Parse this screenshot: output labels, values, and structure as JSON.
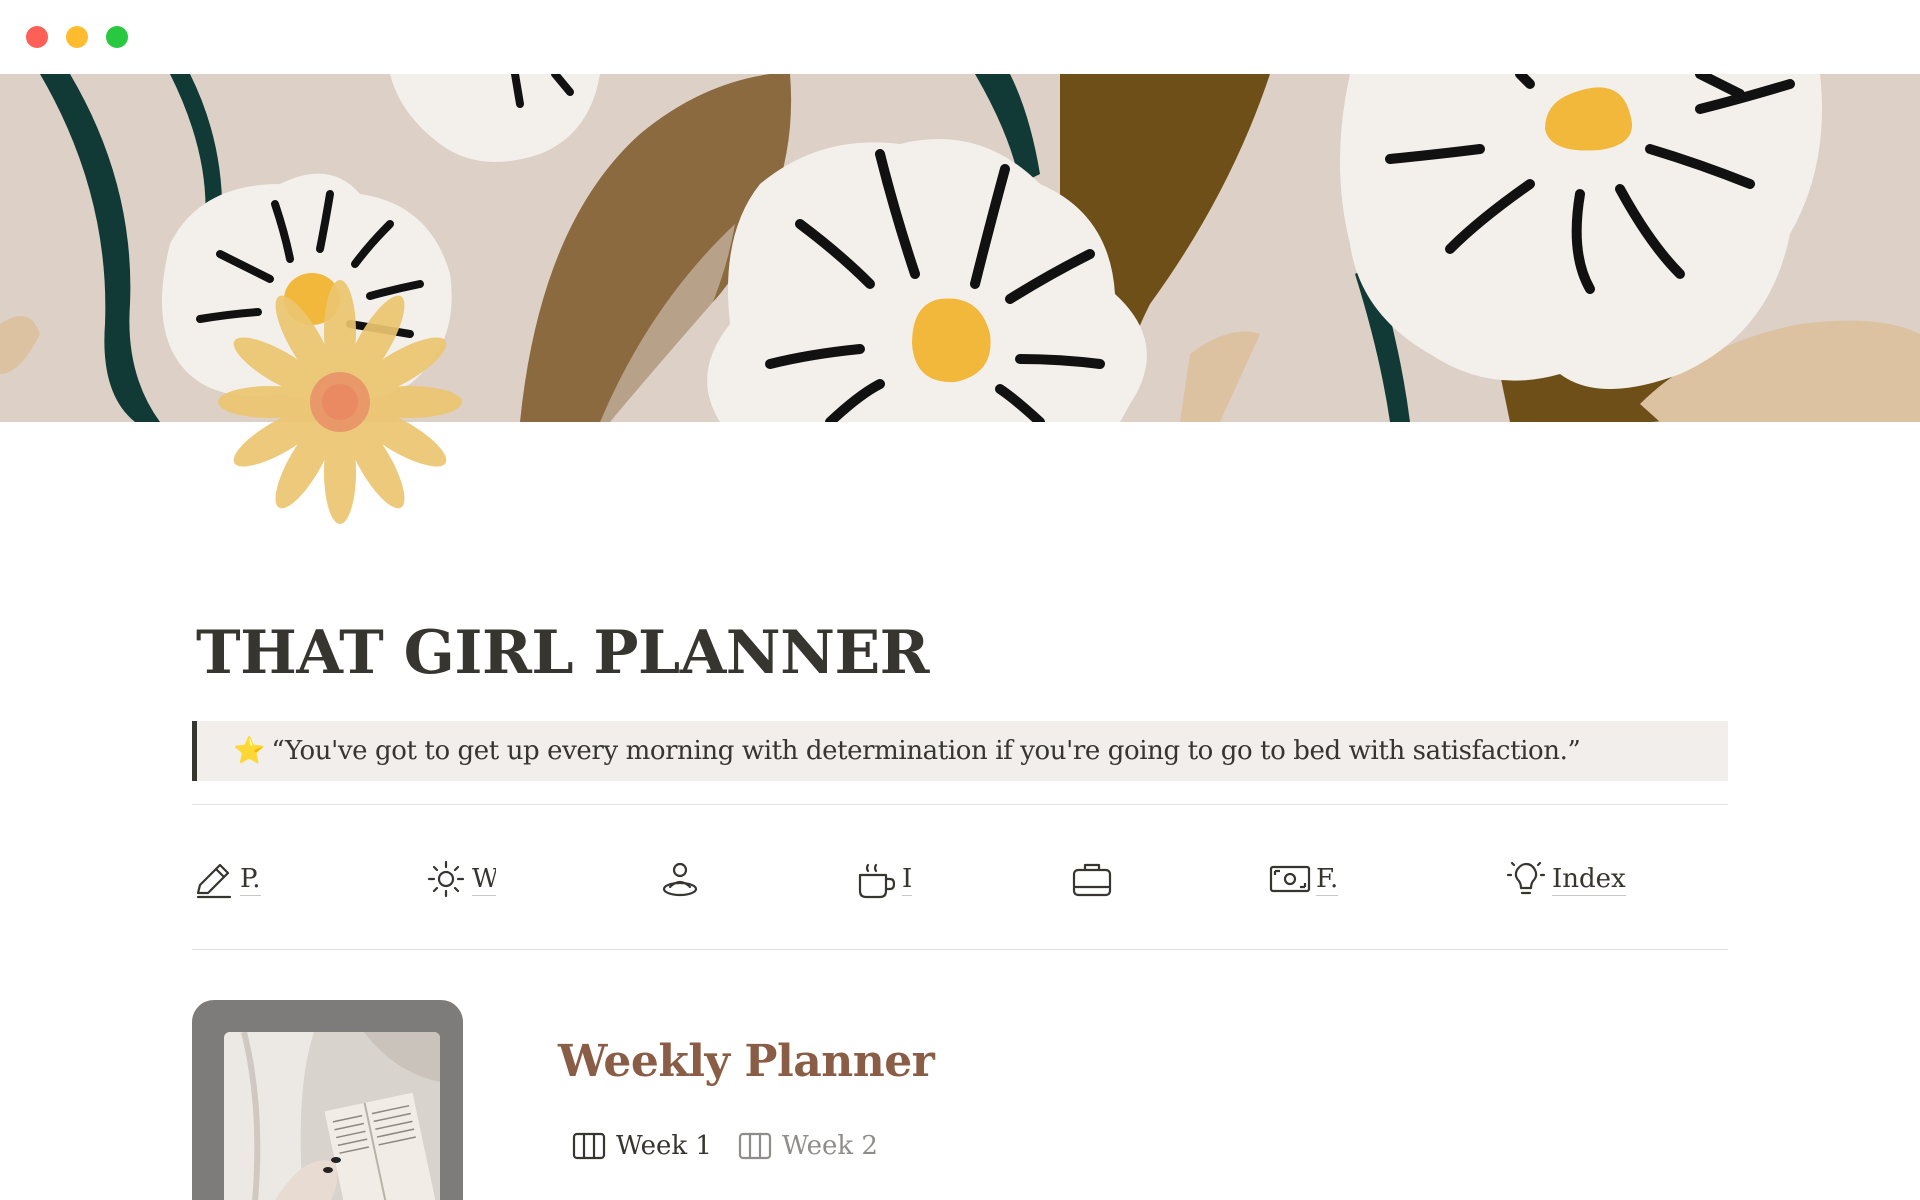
{
  "window": {
    "controls": [
      "close",
      "minimize",
      "maximize"
    ]
  },
  "page": {
    "title": "THAT GIRL PLANNER",
    "icon": "daisy-icon",
    "quote": {
      "emoji": "⭐",
      "text": "“You've got to get up every morning with determination if you're going to go to bed with satisfaction.”"
    }
  },
  "nav": [
    {
      "icon": "pencil-icon",
      "label": "P."
    },
    {
      "icon": "sun-icon",
      "label": "W"
    },
    {
      "icon": "person-icon",
      "label": ""
    },
    {
      "icon": "coffee-icon",
      "label": "I"
    },
    {
      "icon": "briefcase-icon",
      "label": ""
    },
    {
      "icon": "money-icon",
      "label": "F."
    },
    {
      "icon": "lightbulb-icon",
      "label": "Index"
    }
  ],
  "weekly": {
    "title": "Weekly Planner",
    "links": [
      {
        "icon": "board-icon",
        "label": "Week 1"
      },
      {
        "icon": "board-icon",
        "label": "Week 2"
      }
    ]
  },
  "colors": {
    "cover_bg": "#ddd0c6",
    "leaf_brown": "#8a6a3e",
    "leaf_dark": "#6e4f18",
    "stem_green": "#113a36",
    "petal_white": "#f3f0ec",
    "flower_center": "#f2b83c",
    "accent_title": "#8a5d46",
    "quote_bg": "#f1eeec"
  }
}
